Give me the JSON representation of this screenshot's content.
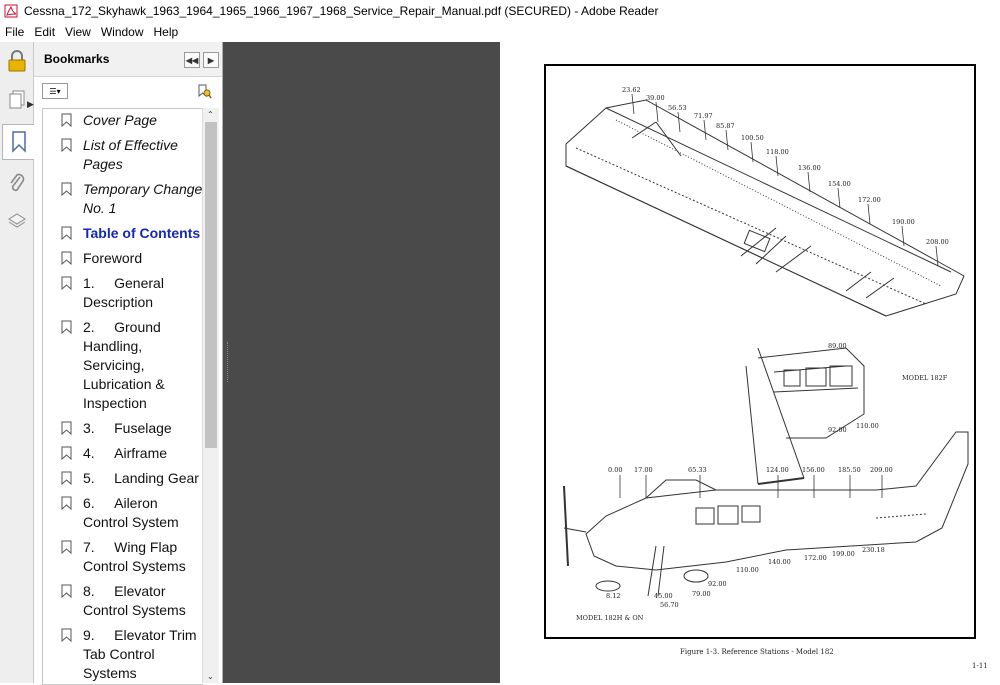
{
  "window": {
    "title": "Cessna_172_Skyhawk_1963_1964_1965_1966_1967_1968_Service_Repair_Manual.pdf (SECURED) - Adobe Reader"
  },
  "menu": [
    "File",
    "Edit",
    "View",
    "Window",
    "Help"
  ],
  "bookmarks": {
    "header": "Bookmarks",
    "items": [
      {
        "label": "Cover Page",
        "style": "italic"
      },
      {
        "label": "List of Effective Pages",
        "style": "italic"
      },
      {
        "label": "Temporary Change No. 1",
        "style": "italic"
      },
      {
        "label": "Table of Contents",
        "style": "selected"
      },
      {
        "label": "Foreword",
        "style": "normal"
      },
      {
        "label": "1.     General Description",
        "style": "normal"
      },
      {
        "label": "2.     Ground Handling, Servicing, Lubrication & Inspection",
        "style": "normal"
      },
      {
        "label": "3.     Fuselage",
        "style": "normal"
      },
      {
        "label": "4.     Airframe",
        "style": "normal"
      },
      {
        "label": "5.     Landing Gear",
        "style": "normal"
      },
      {
        "label": "6.     Aileron Control System",
        "style": "normal"
      },
      {
        "label": "7.     Wing Flap Control Systems",
        "style": "normal"
      },
      {
        "label": "8.     Elevator Control Systems",
        "style": "normal"
      },
      {
        "label": "9.     Elevator Trim Tab Control Systems",
        "style": "normal"
      }
    ]
  },
  "document": {
    "wing_stations": [
      "23.62",
      "39.00",
      "56.53",
      "71.97",
      "85.87",
      "100.50",
      "118.00",
      "136.00",
      "154.00",
      "172.00",
      "190.00",
      "208.00"
    ],
    "inset_stations": [
      "89.00",
      "92.00",
      "110.00"
    ],
    "inset_model": "MODEL 182F",
    "fuselage_top_stations": [
      "0.00",
      "17.00",
      "65.33",
      "124.00",
      "156.00",
      "185.50",
      "209.00"
    ],
    "fuselage_bottom_stations": [
      "8.12",
      "45.00",
      "56.70",
      "79.00",
      "92.00",
      "110.00",
      "140.00",
      "172.00",
      "199.00",
      "230.18"
    ],
    "fuselage_model": "MODEL 182H & ON",
    "caption": "Figure 1-3.  Reference Stations - Model 182",
    "page_number": "1-11"
  },
  "colors": {
    "selected_bookmark": "#1428b4",
    "viewer_bg": "#4a4a4a",
    "acrobat_red": "#c8102e"
  },
  "icons": [
    "acrobat-icon",
    "lock-icon",
    "pages-icon",
    "bookmark-icon",
    "attachment-icon",
    "layers-icon",
    "options-icon",
    "find-bookmark-icon",
    "collapse-icon",
    "expand-icon"
  ]
}
